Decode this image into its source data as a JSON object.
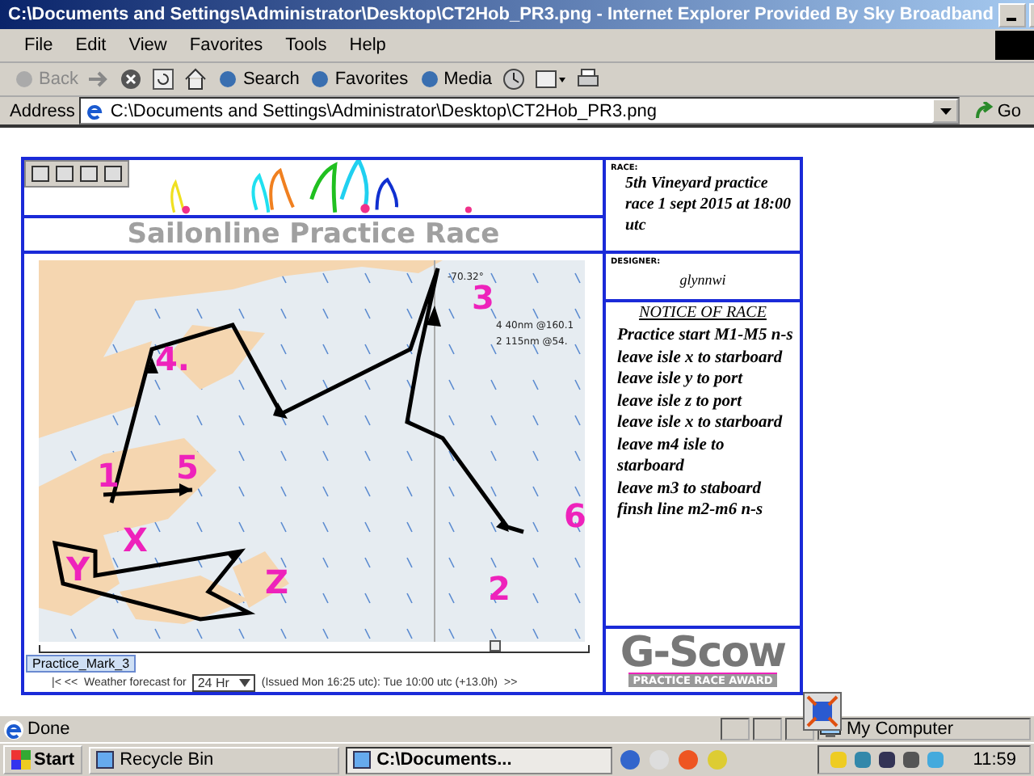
{
  "window": {
    "title": "C:\\Documents and Settings\\Administrator\\Desktop\\CT2Hob_PR3.png - Internet Explorer Provided By Sky Broadband"
  },
  "menu": [
    "File",
    "Edit",
    "View",
    "Favorites",
    "Tools",
    "Help"
  ],
  "toolbar": [
    {
      "label": "Back",
      "disabled": true
    },
    {
      "label": "Search",
      "disabled": false
    },
    {
      "label": "Favorites",
      "disabled": false
    },
    {
      "label": "Media",
      "disabled": false
    }
  ],
  "address": {
    "label": "Address",
    "value": "C:\\Documents and Settings\\Administrator\\Desktop\\CT2Hob_PR3.png",
    "go": "Go"
  },
  "page": {
    "title": "Sailonline Practice Race",
    "race_label": "RACE:",
    "race": "5th Vineyard practice race 1 sept 2015 at 18:00 utc",
    "designer_label": "DESIGNER:",
    "designer": "glynnwi",
    "notice_title": "NOTICE OF RACE",
    "notice_lines": [
      "Practice start M1-M5 n-s",
      "leave isle x to starboard",
      "leave isle y to port",
      "leave isle z to port",
      "leave isle x to starboard",
      "leave m4 isle to starboard",
      "leave m3 to staboard",
      "finsh line m2-m6 n-s"
    ],
    "award": {
      "brand": "G-Scow",
      "tagline": "PRACTICE RACE AWARD"
    },
    "map": {
      "labels": [
        "3",
        "4.",
        "5",
        "1",
        "X",
        "Y",
        "Z",
        "2",
        "6"
      ],
      "readouts": [
        "4 40nm @160.1",
        "2 115nm @54."
      ],
      "coordinate": "-70.32°",
      "tooltip": "Practice_Mark_3",
      "slider": {
        "level": 0.82
      },
      "weather": {
        "nav": "|< <<",
        "label": "Weather forecast for",
        "period": "24 Hr",
        "issued": "(Issued Mon 16:25 utc): Tue 10:00 utc (+13.0h)",
        "next": ">>"
      }
    }
  },
  "status_bar": {
    "text": "Done",
    "zone": "My Computer"
  },
  "taskbar": {
    "start": "Start",
    "items": [
      {
        "label": "Recycle Bin",
        "selected": false
      },
      {
        "label": "C:\\Documents...",
        "selected": true
      }
    ],
    "clock": "11:59"
  }
}
